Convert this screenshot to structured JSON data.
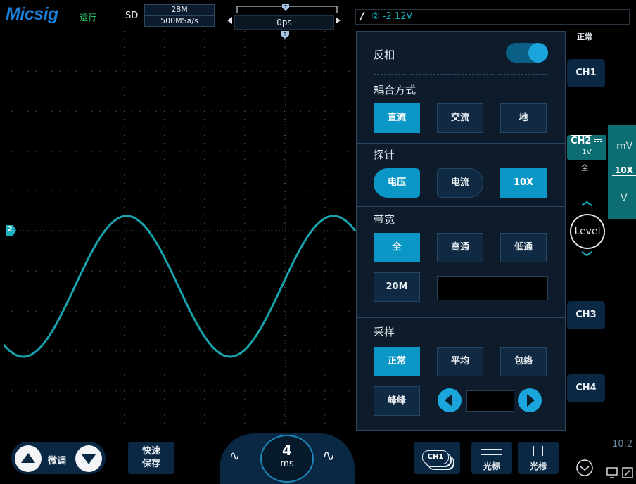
{
  "header": {
    "logo": "Micsig",
    "run_state": "运行",
    "mode": "SD",
    "memory_depth": "28M",
    "sample_rate": "500MSa/s",
    "time_offset": "0ps",
    "trigger_readout": "② -2.12V",
    "acq_status": "正常"
  },
  "panel": {
    "invert_label": "反相",
    "invert_on": true,
    "coupling_label": "耦合方式",
    "coupling_options": [
      "直流",
      "交流",
      "地"
    ],
    "coupling_selected": "直流",
    "probe_label": "探针",
    "probe_type_options": [
      "电压",
      "电流"
    ],
    "probe_type_selected": "电压",
    "probe_ratio": "10X",
    "bandwidth_label": "带宽",
    "bandwidth_options": [
      "全",
      "高通",
      "低通"
    ],
    "bandwidth_selected": "全",
    "bandwidth_limit": "20M",
    "bandwidth_field_value": "",
    "sampling_label": "采样",
    "sampling_options": [
      "正常",
      "平均",
      "包络"
    ],
    "sampling_selected": "正常",
    "peak_option": "峰峰",
    "sampling_field_value": ""
  },
  "right_column": {
    "ch1": "CH1",
    "ch2": "CH2",
    "ch2_scale": "1V",
    "ch2_bw": "全",
    "level": "Level",
    "ch3": "CH3",
    "ch4": "CH4",
    "unit_popup": {
      "top": "mV",
      "mid": "10X",
      "bottom": "V"
    }
  },
  "bottom": {
    "fine_adjust": "微调",
    "quick_save": "快速\n保存",
    "timebase_value": "4",
    "timebase_unit": "ms",
    "ch1_chip": "CH1",
    "cursor_h": "光标",
    "cursor_v": "光标",
    "clock": "10:2"
  },
  "colors": {
    "accent": "#0b97c5",
    "trace_ch2": "#19a3ad",
    "panel_bg": "#0d1b2b",
    "button_bg": "#102a43",
    "brand": "#1a7fd6"
  },
  "waveform": {
    "channel_marker": "2"
  }
}
